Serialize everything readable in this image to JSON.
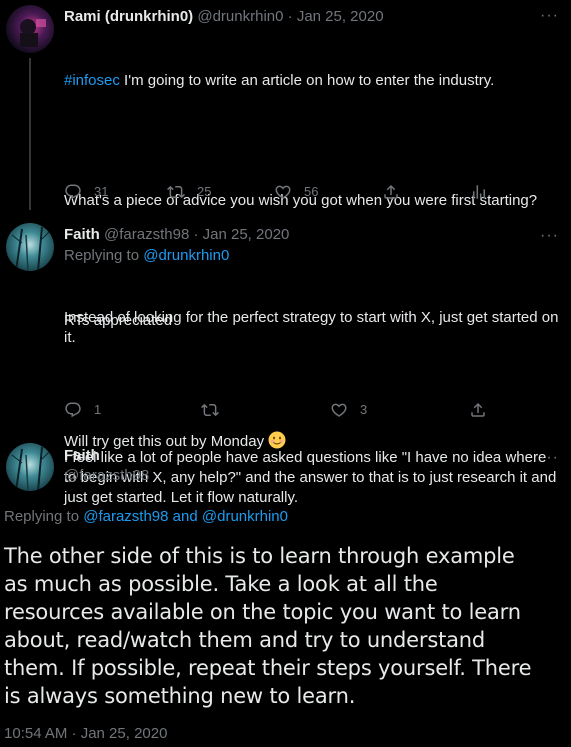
{
  "tweets": [
    {
      "name": "Rami (drunkrhin0)",
      "handle": "@drunkrhin0",
      "sep": "·",
      "date": "Jan 25, 2020",
      "hashtag": "#infosec",
      "text_1": " I'm going to write an article on how to enter the industry.",
      "text_2": "What's a piece of advice you wish you got when you were first starting?",
      "text_3": "RTs appreciated",
      "text_4": "Will try get this out by Monday ",
      "emoji": "smiling-face-icon",
      "replies": "31",
      "retweets": "25",
      "likes": "56"
    },
    {
      "name": "Faith",
      "handle": "@farazsth98",
      "sep": "·",
      "date": "Jan 25, 2020",
      "replying_prefix": "Replying to ",
      "replying_handle": "@drunkrhin0",
      "text_1": "Instead of looking for the perfect strategy to start with X, just get started on it.",
      "text_2": "I feel like a lot of people have asked questions like \"I have no idea where to begin with X, any help?\" and the answer to that is to just research it and just get started. Let it flow naturally.",
      "replies": "1",
      "retweets": "",
      "likes": "3"
    }
  ],
  "focus": {
    "name": "Faith",
    "handle": "@farazsth98",
    "replying_prefix": "Replying to ",
    "replying_handle_1": "@farazsth98",
    "replying_and": " and ",
    "replying_handle_2": "@drunkrhin0",
    "text": "The other side of this is to learn through example as much as possible. Take a look at all the resources available on the topic you want to learn about, read/watch them and try to understand them. If possible, repeat their steps yourself. There is always something new to learn.",
    "timestamp": "10:54 AM · Jan 25, 2020"
  },
  "more_label": "···",
  "colors": {
    "background": "#000000",
    "text": "#e7e9ea",
    "muted": "#71767b",
    "link": "#1d9bf0",
    "thread_line": "#333639"
  }
}
